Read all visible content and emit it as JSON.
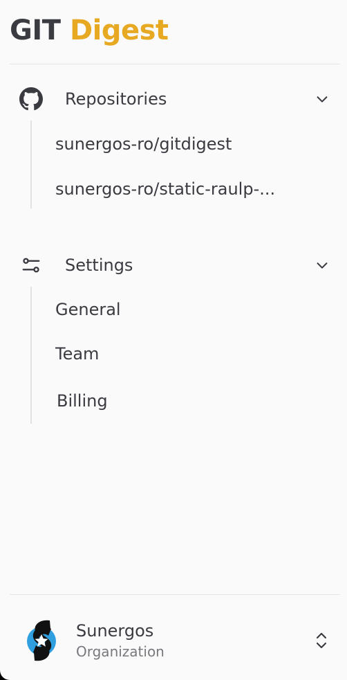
{
  "brand": {
    "part1": "GIT",
    "part2": "Digest",
    "color_dark": "#3a3a41",
    "color_accent": "#e8a922"
  },
  "repositories": {
    "label": "Repositories",
    "icon": "github-icon",
    "items": [
      {
        "label": "sunergos-ro/gitdigest"
      },
      {
        "label": "sunergos-ro/static-raulp-..."
      }
    ]
  },
  "settings": {
    "label": "Settings",
    "icon": "sliders-icon",
    "items": [
      {
        "label": "General"
      },
      {
        "label": "Team"
      },
      {
        "label": "Billing"
      }
    ]
  },
  "org": {
    "name": "Sunergos",
    "type": "Organization",
    "icon": "organization-logo"
  }
}
